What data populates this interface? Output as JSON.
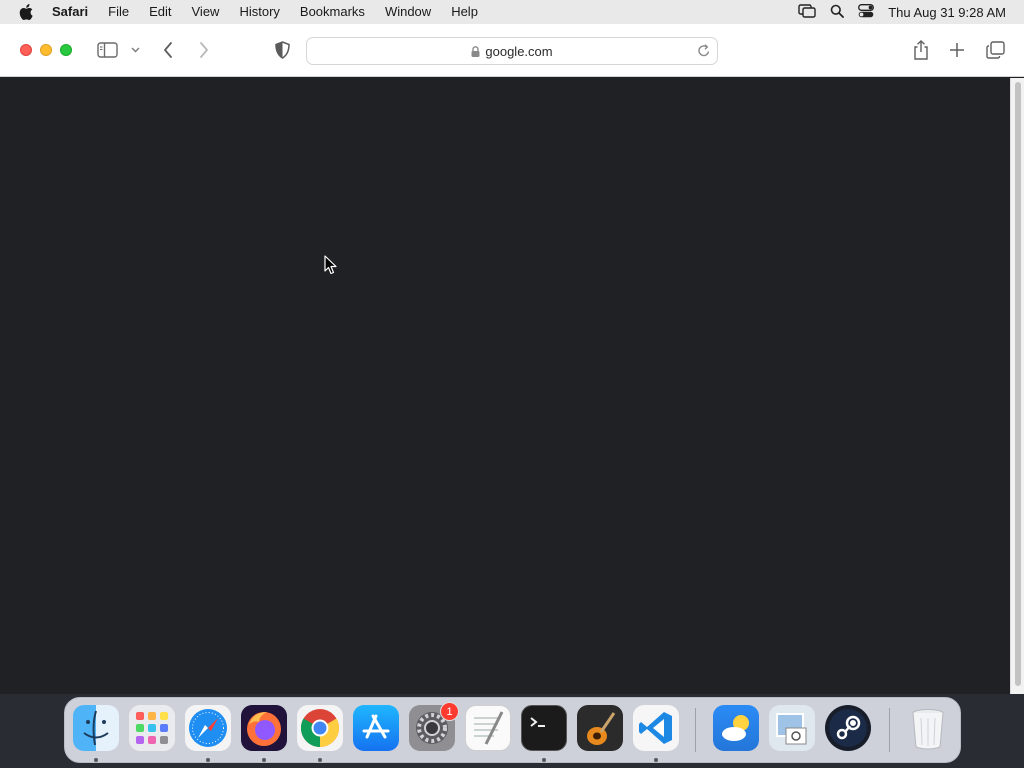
{
  "menubar": {
    "apple_icon": "apple-logo-icon",
    "app_name": "Safari",
    "items": [
      "File",
      "Edit",
      "View",
      "History",
      "Bookmarks",
      "Window",
      "Help"
    ],
    "status_icons": [
      "screen-mirroring-icon",
      "spotlight-search-icon",
      "control-center-icon"
    ],
    "clock": "Thu Aug 31  9:28 AM"
  },
  "browser": {
    "address": "google.com",
    "toolbar_icons": [
      "sidebar-icon",
      "chevron-down-icon",
      "back-icon",
      "forward-icon",
      "privacy-shield-icon",
      "share-icon",
      "new-tab-icon",
      "tab-overview-icon"
    ],
    "content_background": "#202124"
  },
  "dock": {
    "apps": [
      {
        "name": "Finder",
        "icon": "finder-icon",
        "running": true
      },
      {
        "name": "Launchpad",
        "icon": "launchpad-icon",
        "running": false
      },
      {
        "name": "Safari",
        "icon": "safari-icon",
        "running": true
      },
      {
        "name": "Firefox",
        "icon": "firefox-icon",
        "running": true
      },
      {
        "name": "Google Chrome",
        "icon": "chrome-icon",
        "running": true
      },
      {
        "name": "App Store",
        "icon": "app-store-icon",
        "running": false
      },
      {
        "name": "System Settings",
        "icon": "system-settings-icon",
        "running": false,
        "badge": "1"
      },
      {
        "name": "TextEdit",
        "icon": "textedit-icon",
        "running": false
      },
      {
        "name": "Terminal",
        "icon": "terminal-icon",
        "running": true
      },
      {
        "name": "GarageBand",
        "icon": "garageband-icon",
        "running": false
      },
      {
        "name": "Visual Studio Code",
        "icon": "vscode-icon",
        "running": true
      },
      {
        "name": "Weather",
        "icon": "weather-icon",
        "running": false
      },
      {
        "name": "Preview",
        "icon": "preview-icon",
        "running": false
      },
      {
        "name": "Steam",
        "icon": "steam-icon",
        "running": false
      },
      {
        "name": "Trash",
        "icon": "trash-icon",
        "running": false
      }
    ]
  },
  "colors": {
    "close": "#fe5f57",
    "minimize": "#febc2e",
    "maximize": "#28c840",
    "badge": "#ff3b30"
  }
}
